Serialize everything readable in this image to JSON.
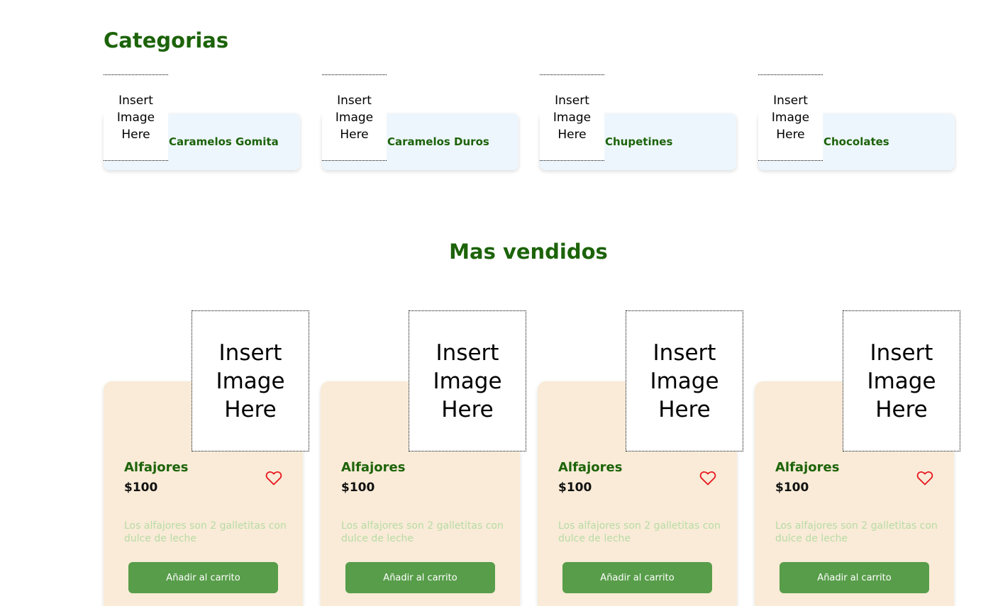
{
  "categories": {
    "title": "Categorias",
    "items": [
      {
        "image_text": "Insert Image Here",
        "label": "Caramelos Gomita"
      },
      {
        "image_text": "Insert Image Here",
        "label": "Caramelos Duros"
      },
      {
        "image_text": "Insert Image Here",
        "label": "Chupetines"
      },
      {
        "image_text": "Insert Image Here",
        "label": "Chocolates"
      }
    ]
  },
  "best_sellers": {
    "title": "Mas vendidos",
    "products": [
      {
        "image_text": "Insert Image Here",
        "name": "Alfajores",
        "price": "$100",
        "description": "Los alfajores son 2 galletitas con dulce de leche",
        "button": "Añadir al carrito",
        "favorite_icon": "heart-outline-icon"
      },
      {
        "image_text": "Insert Image Here",
        "name": "Alfajores",
        "price": "$100",
        "description": "Los alfajores son 2 galletitas con dulce de leche",
        "button": "Añadir al carrito",
        "favorite_icon": "none"
      },
      {
        "image_text": "Insert Image Here",
        "name": "Alfajores",
        "price": "$100",
        "description": "Los alfajores son 2 galletitas con dulce de leche",
        "button": "Añadir al carrito",
        "favorite_icon": "heart-outline-icon"
      },
      {
        "image_text": "Insert Image Here",
        "name": "Alfajores",
        "price": "$100",
        "description": "Los alfajores son 2 galletitas con dulce de leche",
        "button": "Añadir al carrito",
        "favorite_icon": "heart-outline-icon"
      }
    ]
  },
  "colors": {
    "heading": "#1c6309",
    "category_card": "#eef6fd",
    "product_card": "#f9ebd7",
    "button": "#589d4a",
    "description": "#b8dba6",
    "heart": "#e8141c"
  }
}
